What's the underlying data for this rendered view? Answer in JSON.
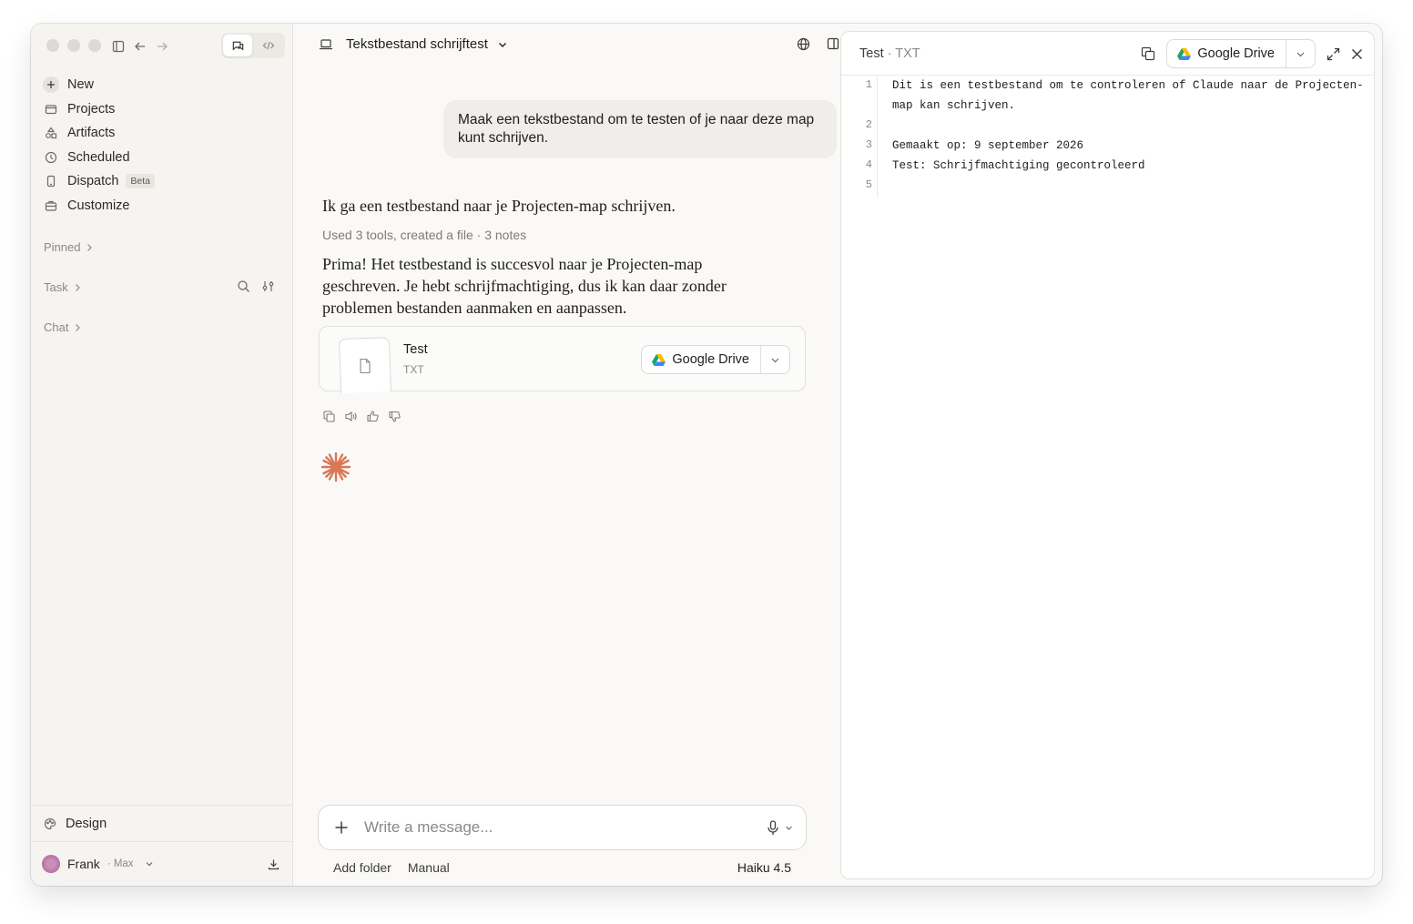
{
  "sidebar": {
    "nav": [
      {
        "label": "New",
        "icon": "plus-icon"
      },
      {
        "label": "Projects",
        "icon": "folder-icon"
      },
      {
        "label": "Artifacts",
        "icon": "artifacts-icon"
      },
      {
        "label": "Scheduled",
        "icon": "clock-icon"
      },
      {
        "label": "Dispatch",
        "icon": "phone-icon",
        "badge": "Beta"
      },
      {
        "label": "Customize",
        "icon": "briefcase-icon"
      }
    ],
    "sections": {
      "pinned": "Pinned",
      "task": "Task",
      "chat": "Chat"
    },
    "design_label": "Design",
    "user": {
      "name": "Frank",
      "plan": "· Max"
    }
  },
  "conversation": {
    "title": "Tekstbestand schrijftest",
    "user_message": "Maak een tekstbestand om te testen of je naar deze map kunt schrijven.",
    "assistant_intro": "Ik ga een testbestand naar je Projecten-map schrijven.",
    "tools_summary": "Used 3 tools, created a file · 3 notes",
    "assistant_reply": "Prima! Het testbestand is succesvol naar je Projecten-map geschreven. Je hebt schrijfmachtiging, dus ik kan daar zonder problemen bestanden aanmaken en aanpassen.",
    "file_card": {
      "name": "Test",
      "type": "TXT",
      "save_label": "Google Drive"
    }
  },
  "composer": {
    "placeholder": "Write a message...",
    "add_folder": "Add folder",
    "mode": "Manual",
    "model": "Haiku 4.5"
  },
  "artifact": {
    "title": "Test",
    "subtitle": "· TXT",
    "save_label": "Google Drive",
    "lines": [
      {
        "n": "1",
        "text": "Dit is een testbestand om te controleren of Claude naar de Projecten-map kan schrijven."
      },
      {
        "n": "2",
        "text": ""
      },
      {
        "n": "3",
        "text": "Gemaakt op: 9 september 2026"
      },
      {
        "n": "4",
        "text": "Test: Schrijfmachtiging gecontroleerd"
      },
      {
        "n": "5",
        "text": ""
      }
    ]
  },
  "colors": {
    "accent_spark": "#d97757",
    "window_bg": "#faf9f7",
    "sidebar_bg": "#f5f4f0"
  }
}
